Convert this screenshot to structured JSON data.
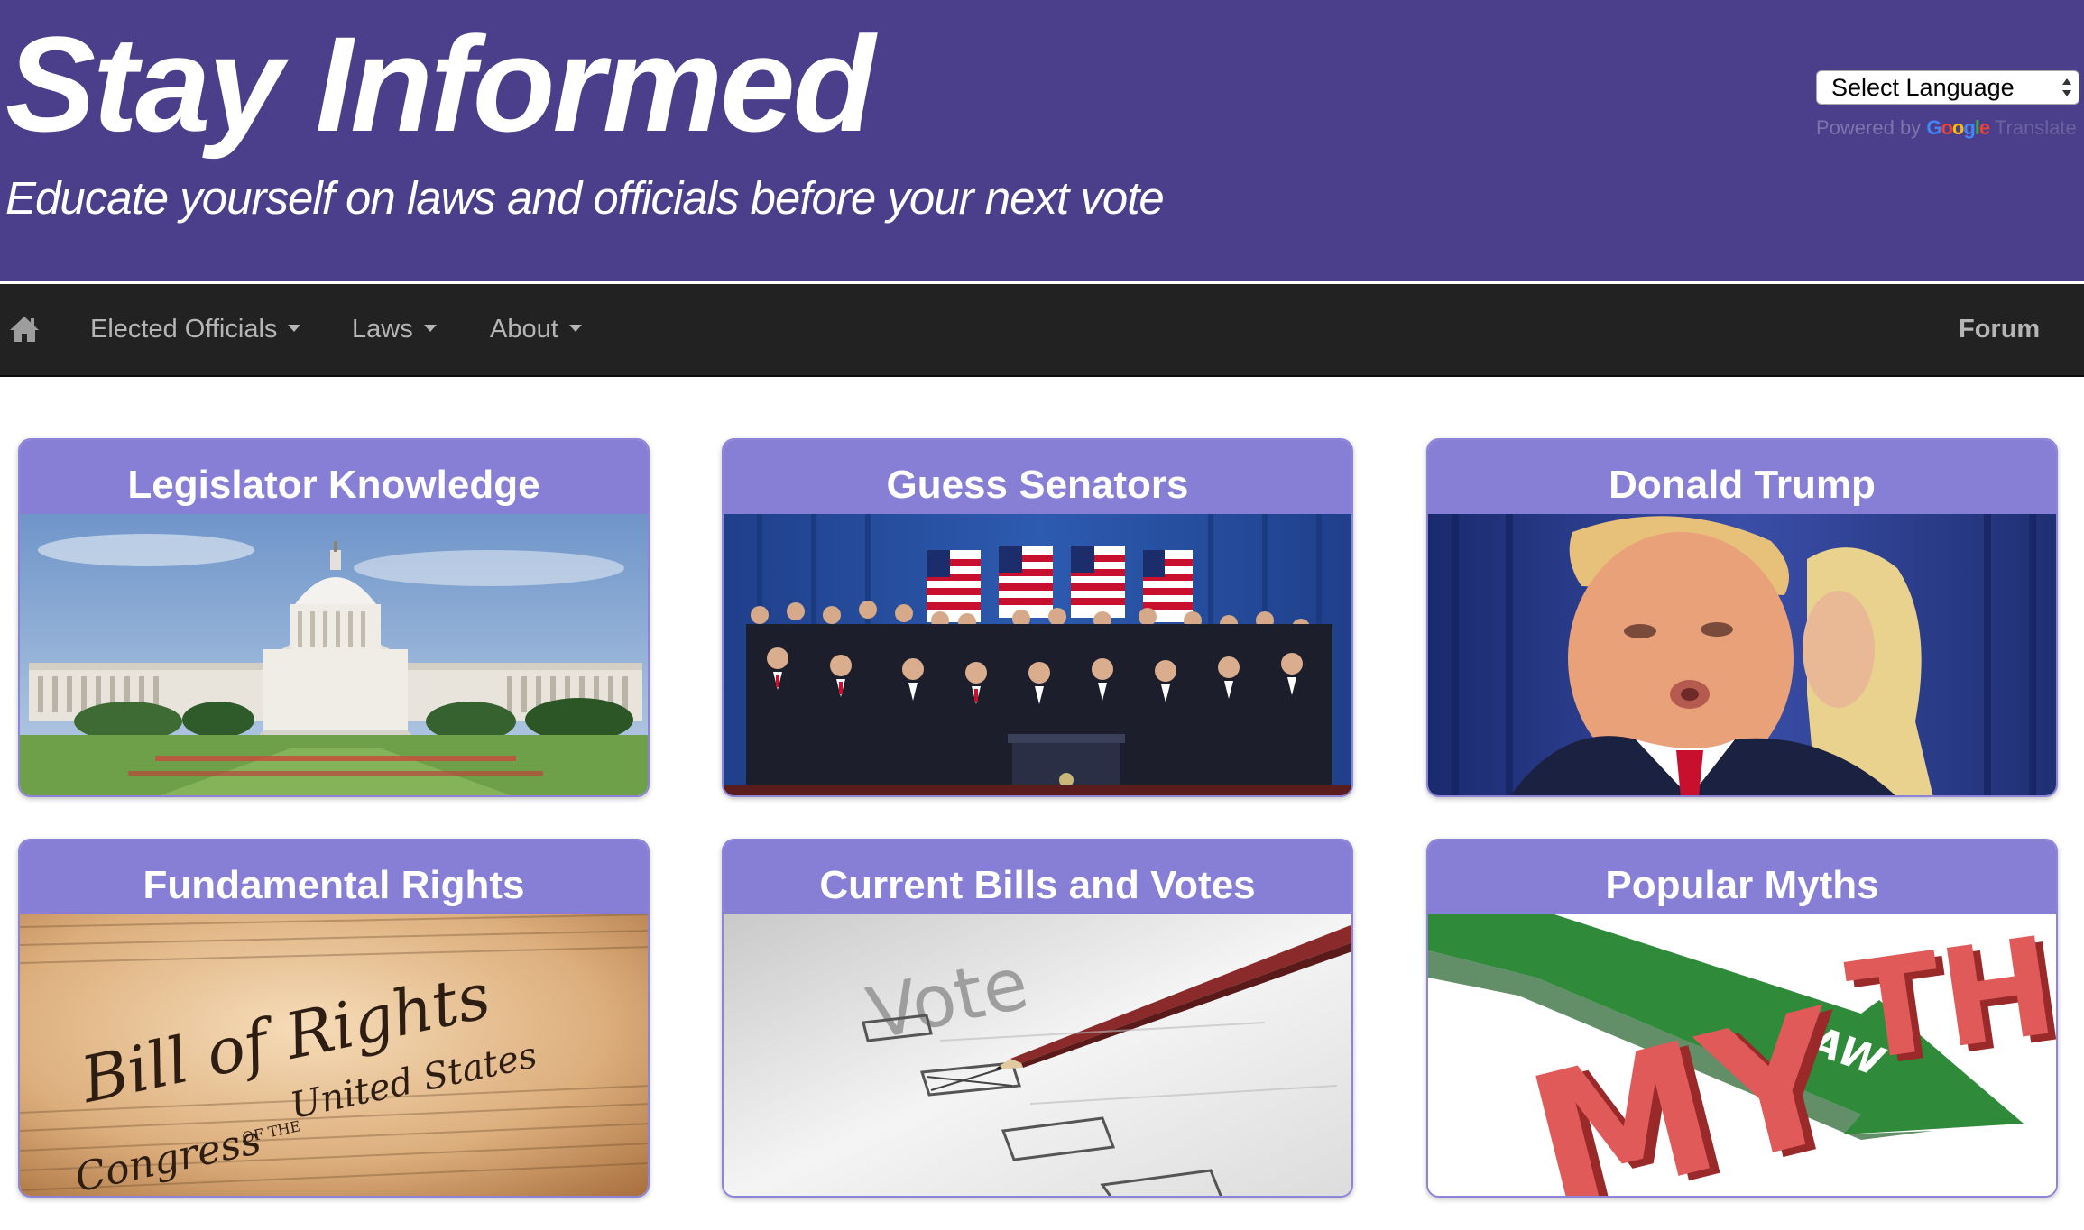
{
  "header": {
    "title": "Stay Informed",
    "tagline": "Educate yourself on laws and officials before your next vote"
  },
  "language": {
    "selected": "Select Language",
    "powered_by": "Powered by",
    "google": "Google",
    "translate": "Translate"
  },
  "nav": {
    "home_icon": "home-icon",
    "items": [
      {
        "label": "Elected Officials"
      },
      {
        "label": "Laws"
      },
      {
        "label": "About"
      }
    ],
    "forum": "Forum"
  },
  "cards": [
    {
      "title": "Legislator Knowledge"
    },
    {
      "title": "Guess Senators"
    },
    {
      "title": "Donald Trump"
    },
    {
      "title": "Fundamental Rights",
      "image_text": [
        "Bill of Rights",
        "Congress",
        "United States",
        "OF THE"
      ]
    },
    {
      "title": "Current Bills and Votes",
      "image_text": [
        "Vote"
      ]
    },
    {
      "title": "Popular Myths",
      "image_text": [
        "MY",
        "TH",
        "LAW"
      ]
    }
  ],
  "colors": {
    "header_bg": "#4b3f8b",
    "navbar_bg": "#222222",
    "card_header": "#877fd6",
    "card_border": "#8d84d8"
  }
}
